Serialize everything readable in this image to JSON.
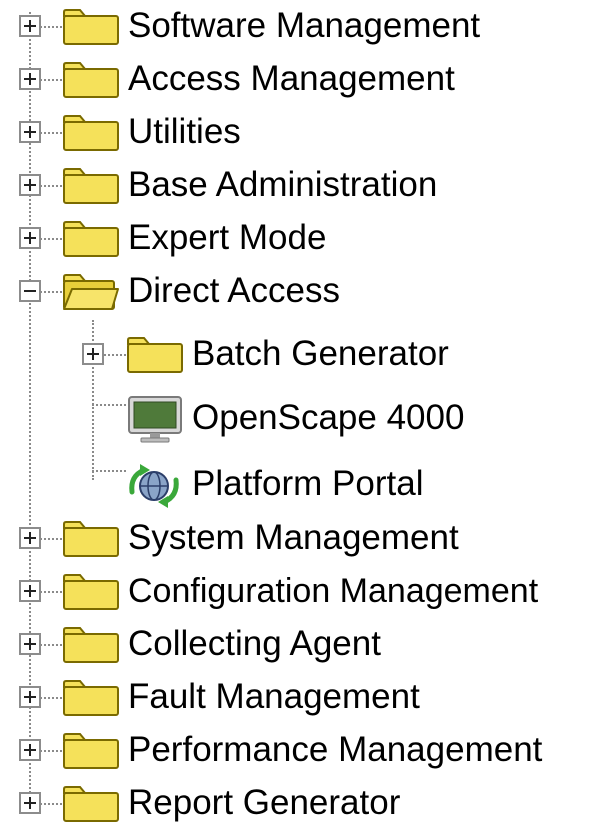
{
  "tree": {
    "items": [
      {
        "label": "Software Management",
        "icon": "folder-icon",
        "state": "collapsed"
      },
      {
        "label": "Access Management",
        "icon": "folder-icon",
        "state": "collapsed"
      },
      {
        "label": "Utilities",
        "icon": "folder-icon",
        "state": "collapsed"
      },
      {
        "label": "Base Administration",
        "icon": "folder-icon",
        "state": "collapsed"
      },
      {
        "label": "Expert Mode",
        "icon": "folder-icon",
        "state": "collapsed"
      },
      {
        "label": "Direct Access",
        "icon": "open-folder-icon",
        "state": "expanded",
        "children": [
          {
            "label": "Batch Generator",
            "icon": "folder-icon",
            "state": "collapsed"
          },
          {
            "label": "OpenScape 4000",
            "icon": "monitor-icon",
            "state": "leaf"
          },
          {
            "label": "Platform Portal",
            "icon": "portal-globe-icon",
            "state": "leaf"
          }
        ]
      },
      {
        "label": "System Management",
        "icon": "folder-icon",
        "state": "collapsed"
      },
      {
        "label": "Configuration Management",
        "icon": "folder-icon",
        "state": "collapsed"
      },
      {
        "label": "Collecting Agent",
        "icon": "folder-icon",
        "state": "collapsed"
      },
      {
        "label": "Fault Management",
        "icon": "folder-icon",
        "state": "collapsed"
      },
      {
        "label": "Performance Management",
        "icon": "folder-icon",
        "state": "collapsed"
      },
      {
        "label": "Report Generator",
        "icon": "folder-icon",
        "state": "collapsed"
      }
    ]
  },
  "colors": {
    "folder_fill": "#f5e15a",
    "folder_stroke": "#7a6a00",
    "tree_line": "#8a8a8a",
    "expander_border": "#8c8c8c"
  }
}
